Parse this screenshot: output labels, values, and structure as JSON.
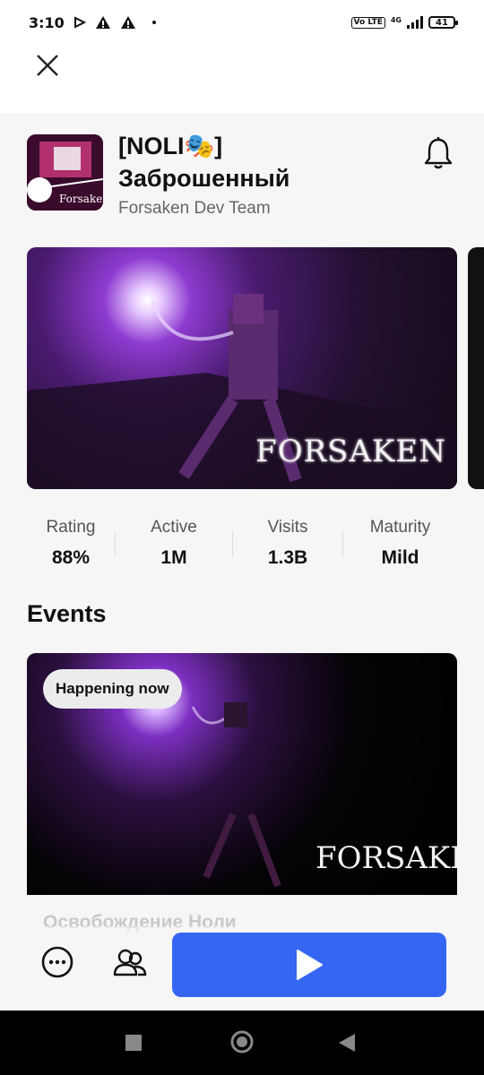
{
  "status_bar": {
    "time": "3:10",
    "network": "4G",
    "volte": "Vo LTE",
    "battery": "41"
  },
  "game": {
    "title_line1": "[NOLI🎭]",
    "title_line2": "Заброшенный",
    "developer": "Forsaken Dev Team",
    "logo_text": "FORSAKEN"
  },
  "stats": [
    {
      "label": "Rating",
      "value": "88%"
    },
    {
      "label": "Active",
      "value": "1M"
    },
    {
      "label": "Visits",
      "value": "1.3B"
    },
    {
      "label": "Maturity",
      "value": "Mild"
    }
  ],
  "events": {
    "heading": "Events",
    "badge": "Happening now",
    "event_title": "Освобождение Ноли"
  },
  "colors": {
    "play_button": "#3566f2",
    "background": "#f6f6f7"
  },
  "icons": {
    "close": "close-icon",
    "bell": "bell-icon",
    "more": "more-icon",
    "friends": "friends-icon",
    "play": "play-icon"
  }
}
